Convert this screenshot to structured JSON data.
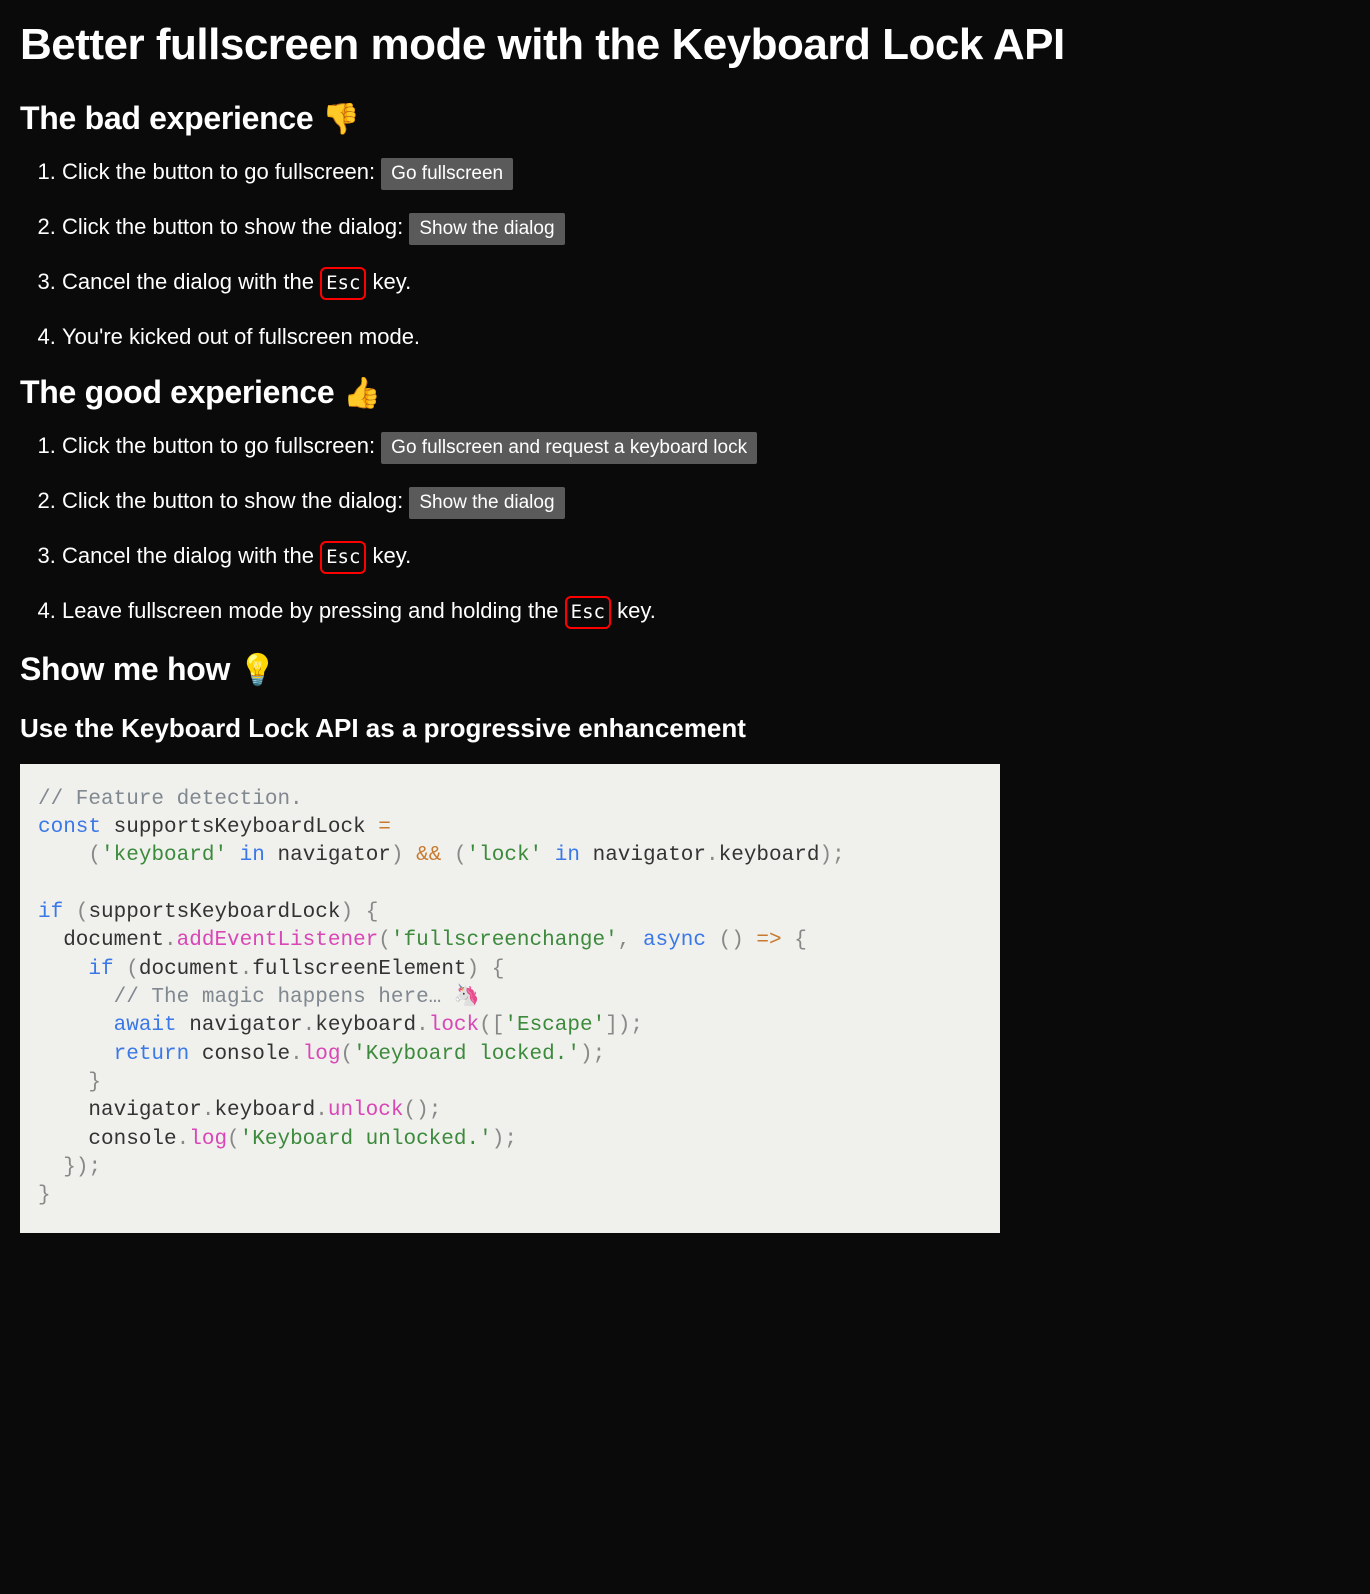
{
  "title": "Better fullscreen mode with the Keyboard Lock API",
  "bad": {
    "heading": "The bad experience ",
    "emoji": "👎",
    "step1_pre": "Click the button to go fullscreen: ",
    "step1_btn": "Go fullscreen",
    "step2_pre": "Click the button to show the dialog: ",
    "step2_btn": "Show the dialog",
    "step3_pre": "Cancel the dialog with the ",
    "step3_kbd": "Esc",
    "step3_post": " key.",
    "step4": "You're kicked out of fullscreen mode."
  },
  "good": {
    "heading": "The good experience ",
    "emoji": "👍",
    "step1_pre": "Click the button to go fullscreen: ",
    "step1_btn": "Go fullscreen and request a keyboard lock",
    "step2_pre": "Click the button to show the dialog: ",
    "step2_btn": "Show the dialog",
    "step3_pre": "Cancel the dialog with the ",
    "step3_kbd": "Esc",
    "step3_post": " key.",
    "step4_pre": "Leave fullscreen mode by pressing and holding the ",
    "step4_kbd": "Esc",
    "step4_post": " key."
  },
  "how": {
    "heading": "Show me how ",
    "emoji": "💡",
    "subheading": "Use the Keyboard Lock API as a progressive enhancement"
  },
  "code": {
    "line1_comment": "// Feature detection.",
    "l2_const": "const",
    "l2_name": " supportsKeyboardLock ",
    "l2_eq": "=",
    "l3_indent": "    ",
    "l3_p1": "(",
    "l3_s1": "'keyboard'",
    "l3_in1": " in ",
    "l3_nav1": "navigator",
    "l3_p2": ")",
    "l3_and": " && ",
    "l3_p3": "(",
    "l3_s2": "'lock'",
    "l3_in2": " in ",
    "l3_nav2": "navigator",
    "l3_dot": ".",
    "l3_kb": "keyboard",
    "l3_p4": ")",
    "l3_semi": ";",
    "l5_if": "if",
    "l5_sp": " ",
    "l5_p1": "(",
    "l5_cond": "supportsKeyboardLock",
    "l5_p2": ")",
    "l5_sp2": " ",
    "l5_brace": "{",
    "l6_indent": "  document",
    "l6_dot": ".",
    "l6_method": "addEventListener",
    "l6_p1": "(",
    "l6_s1": "'fullscreenchange'",
    "l6_comma": ",",
    "l6_sp": " ",
    "l6_async": "async",
    "l6_sp2": " ",
    "l6_p2": "(",
    "l6_p3": ")",
    "l6_sp3": " ",
    "l6_arrow": "=>",
    "l6_sp4": " ",
    "l6_brace": "{",
    "l7_indent": "    ",
    "l7_if": "if",
    "l7_sp": " ",
    "l7_p1": "(",
    "l7_doc": "document",
    "l7_dot": ".",
    "l7_fe": "fullscreenElement",
    "l7_p2": ")",
    "l7_sp2": " ",
    "l7_brace": "{",
    "l8_indent": "      ",
    "l8_comment": "// The magic happens here… 🦄",
    "l9_indent": "      ",
    "l9_await": "await",
    "l9_sp": " navigator",
    "l9_dot1": ".",
    "l9_kb": "keyboard",
    "l9_dot2": ".",
    "l9_lock": "lock",
    "l9_p1": "(",
    "l9_b1": "[",
    "l9_s1": "'Escape'",
    "l9_b2": "]",
    "l9_p2": ")",
    "l9_semi": ";",
    "l10_indent": "      ",
    "l10_return": "return",
    "l10_sp": " console",
    "l10_dot": ".",
    "l10_log": "log",
    "l10_p1": "(",
    "l10_s1": "'Keyboard locked.'",
    "l10_p2": ")",
    "l10_semi": ";",
    "l11_indent": "    ",
    "l11_brace": "}",
    "l12_indent": "    navigator",
    "l12_dot1": ".",
    "l12_kb": "keyboard",
    "l12_dot2": ".",
    "l12_unlock": "unlock",
    "l12_p1": "(",
    "l12_p2": ")",
    "l12_semi": ";",
    "l13_indent": "    console",
    "l13_dot": ".",
    "l13_log": "log",
    "l13_p1": "(",
    "l13_s1": "'Keyboard unlocked.'",
    "l13_p2": ")",
    "l13_semi": ";",
    "l14_indent": "  ",
    "l14_brace": "}",
    "l14_p": ")",
    "l14_semi": ";",
    "l15_brace": "}"
  }
}
